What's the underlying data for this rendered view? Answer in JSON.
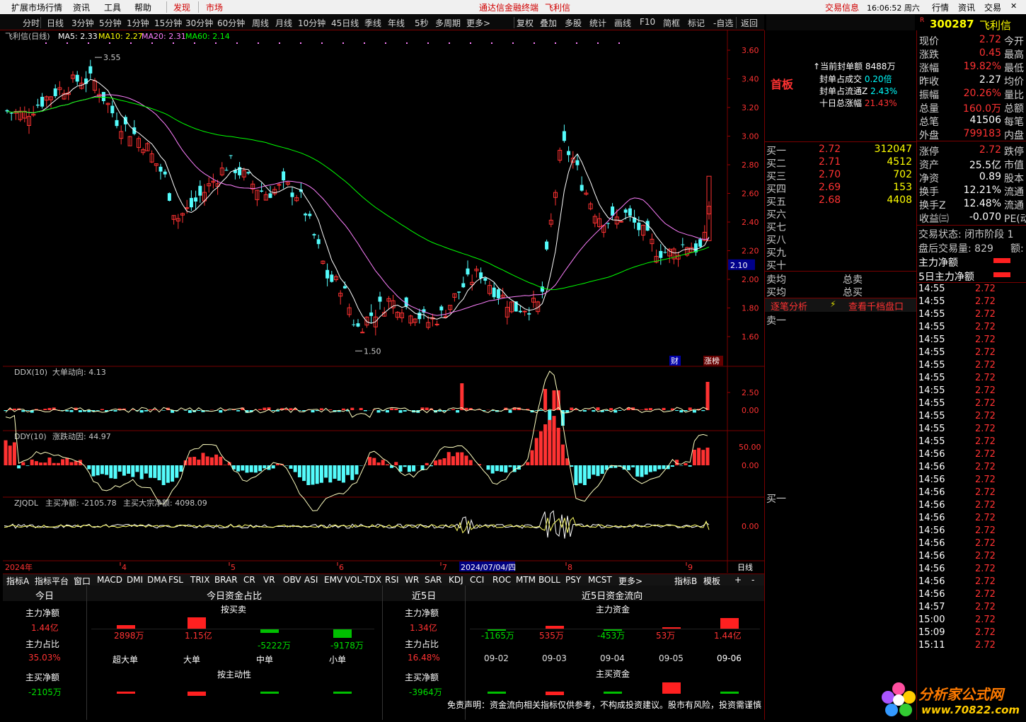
{
  "menu": {
    "items": [
      "扩展市场行情",
      "资讯",
      "工具",
      "帮助",
      "发现",
      "市场",
      "通达信金融终端",
      "飞利信",
      "交易信息",
      "16:06:52 周六",
      "行情",
      "资讯",
      "交易"
    ]
  },
  "periods": [
    "分时",
    "日线",
    "3分钟",
    "5分钟",
    "1分钟",
    "15分钟",
    "30分钟",
    "60分钟",
    "周线",
    "月线",
    "10分钟",
    "45日线",
    "季线",
    "年线",
    "5秒",
    "多周期",
    "更多>",
    "复权",
    "叠加",
    "多股",
    "统计",
    "画线",
    "F10",
    "简框",
    "标记",
    "-自选",
    "返回"
  ],
  "title_bar": {
    "name": "飞利信(日线)",
    "ma5": "MA5: 2.33",
    "ma10": "MA10: 2.27",
    "ma20": "MA20: 2.31",
    "ma60": "MA60: 2.14",
    "high_label": "3.55",
    "low_label": "1.50",
    "current_price_tag": "2.10",
    "badge_cai": "财",
    "badge_zhang": "涨榜"
  },
  "price_axis": [
    "3.60",
    "3.40",
    "3.20",
    "3.00",
    "2.80",
    "2.60",
    "2.40",
    "2.20",
    "2.00",
    "1.80",
    "1.60"
  ],
  "ddx": {
    "label": "DDX(10)",
    "name": "大单动向: 4.13",
    "axis": [
      "2.50",
      "0.00"
    ]
  },
  "ddy": {
    "label": "DDY(10)",
    "name": "涨跌动因: 44.97",
    "axis": [
      "50.00",
      "0.00"
    ]
  },
  "zjqdl": {
    "label": "ZJQDL",
    "a": "主买净额: -2105.78",
    "b": "主买大宗净额: 4098.09",
    "axis": [
      "0.00"
    ]
  },
  "date_axis": {
    "year": "2024年",
    "m4": "4",
    "m5": "5",
    "m6": "6",
    "m7": "7",
    "cursor": "2024/07/04/四",
    "m8": "8",
    "m9": "9",
    "period": "日线"
  },
  "tabs": [
    "指标A",
    "指标平台",
    "窗口",
    "MACD",
    "DMI",
    "DMA",
    "FSL",
    "TRIX",
    "BRAR",
    "CR",
    "VR",
    "OBV",
    "ASI",
    "EMV",
    "VOL-TDX",
    "RSI",
    "WR",
    "SAR",
    "KDJ",
    "CCI",
    "ROC",
    "MTM",
    "BOLL",
    "PSY",
    "MCST",
    "更多>",
    "指标B",
    "模板",
    "+",
    "-"
  ],
  "funds": {
    "today": "今日",
    "today_ratio": "今日资金占比",
    "five": "近5日",
    "five_flow": "近5日资金流向",
    "main_net": "主力净额",
    "main_net_val": "1.44亿",
    "main_ratio": "主力占比",
    "main_ratio_val": "35.03%",
    "buy_net": "主买净额",
    "buy_net_val": "-2105万",
    "by_trade": "按买卖",
    "by_active": "按主动性",
    "bars": [
      {
        "v": "2898万",
        "c": "超大单"
      },
      {
        "v": "1.15亿",
        "c": "大单"
      },
      {
        "v": "-5222万",
        "c": "中单"
      },
      {
        "v": "-9178万",
        "c": "小单"
      }
    ],
    "five_net": "1.34亿",
    "five_ratio": "16.48%",
    "five_buy": "-3964万",
    "main_fund": "主力资金",
    "main_buy": "主买资金",
    "days": [
      {
        "v": "-1165万",
        "d": "09-02"
      },
      {
        "v": "535万",
        "d": "09-03"
      },
      {
        "v": "-453万",
        "d": "09-04"
      },
      {
        "v": "53万",
        "d": "09-05"
      },
      {
        "v": "1.44亿",
        "d": "09-06"
      }
    ],
    "disclaimer": "免责声明：资金流向相关指标仅供参考，不构成投资建议。股市有风险，投资需谨慎"
  },
  "orderbook": {
    "first": "首板",
    "seal_amount": "当前封单额",
    "seal_amount_v": "8488万",
    "seal_vol": "封单占成交",
    "seal_vol_v": "0.20倍",
    "seal_float": "封单占流通Z",
    "seal_float_v": "2.43%",
    "ten_day": "十日总涨幅",
    "ten_day_v": "21.43%",
    "sells": [
      "卖一"
    ],
    "buys": [
      {
        "l": "买一",
        "p": "2.72",
        "v": "312047"
      },
      {
        "l": "买二",
        "p": "2.71",
        "v": "4512"
      },
      {
        "l": "买三",
        "p": "2.70",
        "v": "702"
      },
      {
        "l": "买四",
        "p": "2.69",
        "v": "153"
      },
      {
        "l": "买五",
        "p": "2.68",
        "v": "4408"
      },
      {
        "l": "买六"
      },
      {
        "l": "买七"
      },
      {
        "l": "买八"
      },
      {
        "l": "买九"
      },
      {
        "l": "买十"
      }
    ],
    "sell_avg": "卖均",
    "total_sell": "总卖",
    "buy_avg": "买均",
    "total_buy": "总买",
    "tick_analysis": "逐笔分析",
    "view_thousand": "查看千档盘口",
    "buy_one": "买一"
  },
  "quote": {
    "code": "300287",
    "name": "飞利信",
    "rows": [
      {
        "l": "现价",
        "v": "2.72",
        "r": "今开"
      },
      {
        "l": "涨跌",
        "v": "0.45",
        "r": "最高"
      },
      {
        "l": "涨幅",
        "v": "19.82%",
        "r": "最低"
      },
      {
        "l": "昨收",
        "v": "2.27",
        "r": "均价"
      },
      {
        "l": "振幅",
        "v": "20.26%",
        "r": "量比"
      },
      {
        "l": "总量",
        "v": "160.0万",
        "r": "总额"
      },
      {
        "l": "总笔",
        "v": "41506",
        "r": "每笔"
      },
      {
        "l": "外盘",
        "v": "799183",
        "r": "内盘"
      }
    ],
    "rows2": [
      {
        "l": "涨停",
        "v": "2.72",
        "r": "跌停"
      },
      {
        "l": "资产",
        "v": "25.5亿",
        "r": "市值"
      },
      {
        "l": "净资",
        "v": "0.89",
        "r": "股本"
      },
      {
        "l": "换手",
        "v": "12.21%",
        "r": "流通"
      },
      {
        "l": "换手Z",
        "v": "12.48%",
        "r": "流通"
      },
      {
        "l": "收益㈢",
        "v": "-0.070",
        "r": "PE(动)"
      }
    ],
    "state": "交易状态: 闭市阶段 1",
    "after": "盘后交易量: 829",
    "after_r": "额:",
    "main_net": "主力净额",
    "main5": "5日主力净额"
  },
  "ticks": [
    {
      "t": "14:55",
      "p": "2.72"
    },
    {
      "t": "14:55",
      "p": "2.72"
    },
    {
      "t": "14:55",
      "p": "2.72"
    },
    {
      "t": "14:55",
      "p": "2.72"
    },
    {
      "t": "14:55",
      "p": "2.72"
    },
    {
      "t": "14:55",
      "p": "2.72"
    },
    {
      "t": "14:55",
      "p": "2.72"
    },
    {
      "t": "14:55",
      "p": "2.72"
    },
    {
      "t": "14:55",
      "p": "2.72"
    },
    {
      "t": "14:55",
      "p": "2.72"
    },
    {
      "t": "14:55",
      "p": "2.72"
    },
    {
      "t": "14:55",
      "p": "2.72"
    },
    {
      "t": "14:55",
      "p": "2.72"
    },
    {
      "t": "14:56",
      "p": "2.72"
    },
    {
      "t": "14:56",
      "p": "2.72"
    },
    {
      "t": "14:56",
      "p": "2.72"
    },
    {
      "t": "14:56",
      "p": "2.72"
    },
    {
      "t": "14:56",
      "p": "2.72"
    },
    {
      "t": "14:56",
      "p": "2.72"
    },
    {
      "t": "14:56",
      "p": "2.72"
    },
    {
      "t": "14:56",
      "p": "2.72"
    },
    {
      "t": "14:56",
      "p": "2.72"
    },
    {
      "t": "14:56",
      "p": "2.72"
    },
    {
      "t": "14:56",
      "p": "2.72"
    },
    {
      "t": "14:56",
      "p": "2.72"
    },
    {
      "t": "14:57",
      "p": "2.72"
    },
    {
      "t": "15:00",
      "p": "2.72"
    },
    {
      "t": "15:09",
      "p": "2.72"
    },
    {
      "t": "15:11",
      "p": "2.72"
    }
  ],
  "logo": {
    "text": "分析家公式网",
    "url": "www.70822.com"
  },
  "colors": {
    "up": "#ff3232",
    "down": "#54fcfc",
    "ma5": "#ffffff",
    "ma10": "#ffff00",
    "ma20": "#ff80ff",
    "ma60": "#00ff00"
  }
}
